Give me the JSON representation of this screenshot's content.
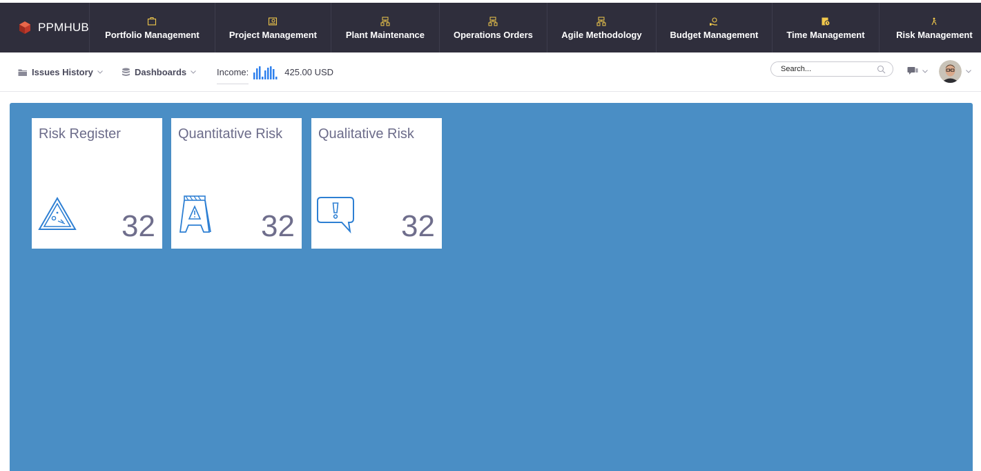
{
  "brand": {
    "name": "PPMHUB"
  },
  "nav": [
    {
      "label": "Portfolio Management",
      "icon": "briefcase-icon"
    },
    {
      "label": "Project Management",
      "icon": "project-icon"
    },
    {
      "label": "Plant Maintenance",
      "icon": "network-icon"
    },
    {
      "label": "Operations Orders",
      "icon": "network-icon"
    },
    {
      "label": "Agile Methodology",
      "icon": "network-icon"
    },
    {
      "label": "Budget Management",
      "icon": "money-hand-icon"
    },
    {
      "label": "Time Management",
      "icon": "clock-icon"
    },
    {
      "label": "Risk Management",
      "icon": "risk-icon"
    }
  ],
  "subbar": {
    "issues_history": "Issues History",
    "dashboards": "Dashboards",
    "income_label": "Income:",
    "income_value": "425.00 USD",
    "search_placeholder": "Search..."
  },
  "cards": [
    {
      "title": "Risk Register",
      "count": "32",
      "icon": "warning-triangle-icon"
    },
    {
      "title": "Quantitative Risk",
      "count": "32",
      "icon": "caution-sign-icon"
    },
    {
      "title": "Qualitative Risk",
      "count": "32",
      "icon": "exclamation-bubble-icon"
    }
  ],
  "colors": {
    "topbar": "#2f2e3c",
    "nav_icon": "#f2c94c",
    "panel": "#4a8ec5",
    "card_icon": "#2d7fd3",
    "card_text": "#6c6c8a",
    "income_chart": "#2f80ed"
  }
}
